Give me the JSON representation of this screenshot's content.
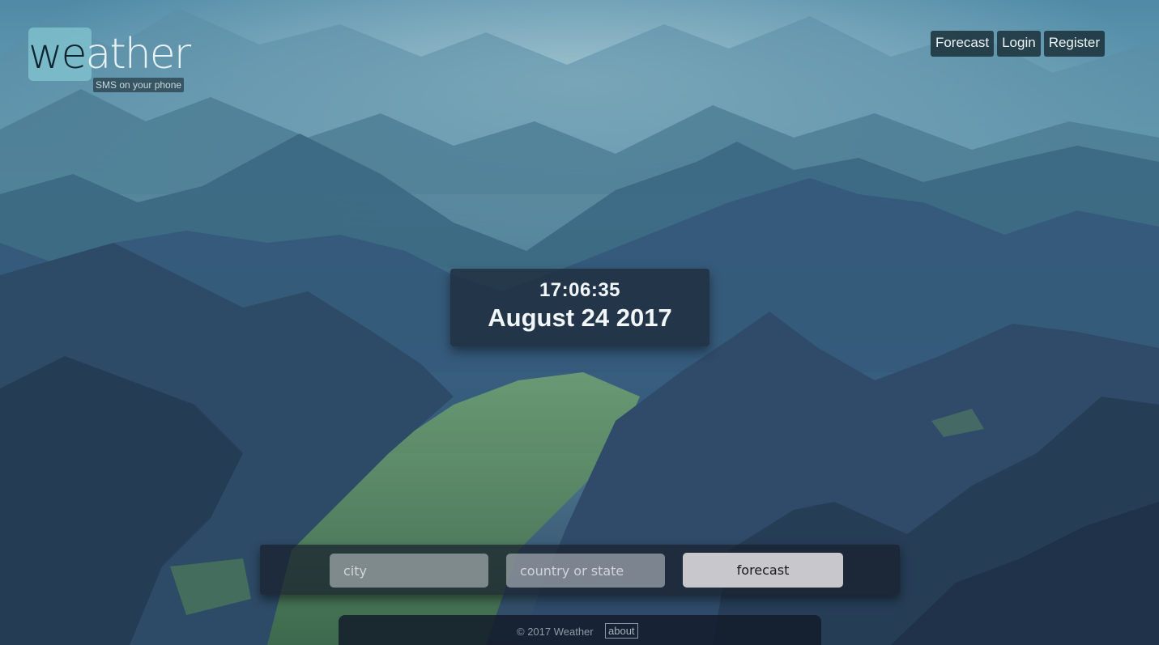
{
  "colors": {
    "sky": "#5d95ad",
    "mountain_dark": "#243a55",
    "valley_green": "#5f8f5e",
    "logo_accent": "#7fbfcc"
  },
  "logo": {
    "part_dark": "we",
    "part_light": "ather",
    "tagline": "SMS on your phone"
  },
  "nav": {
    "forecast": "Forecast",
    "login": "Login",
    "register": "Register"
  },
  "clock": {
    "time": "17:06:35",
    "date": "August 24 2017"
  },
  "form": {
    "city_placeholder": "city",
    "country_placeholder": "country or state",
    "submit_label": "forecast"
  },
  "footer": {
    "copyright": "© 2017 Weather",
    "about": "about"
  }
}
